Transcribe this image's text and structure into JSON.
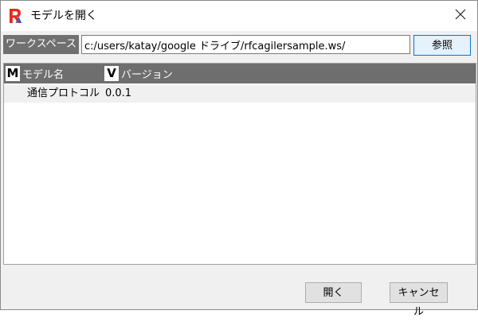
{
  "window": {
    "title": "モデルを開く"
  },
  "workspace": {
    "label": "ワークスペース",
    "path": "c:/users/katay/google ドライブ/rfcagilersample.ws/",
    "browse_label": "参照"
  },
  "list": {
    "columns": [
      {
        "badge": "M",
        "label": "モデル名"
      },
      {
        "badge": "V",
        "label": "バージョン"
      }
    ],
    "rows": [
      {
        "name": "通信プロトコル",
        "version": "0.0.1"
      }
    ]
  },
  "footer": {
    "open_label": "開く",
    "cancel_label": "キャンセル"
  },
  "colors": {
    "header_bg": "#6e6e6e",
    "accent": "#0078d7",
    "logo_red": "#e8281e",
    "logo_blue": "#1f5fc2"
  }
}
